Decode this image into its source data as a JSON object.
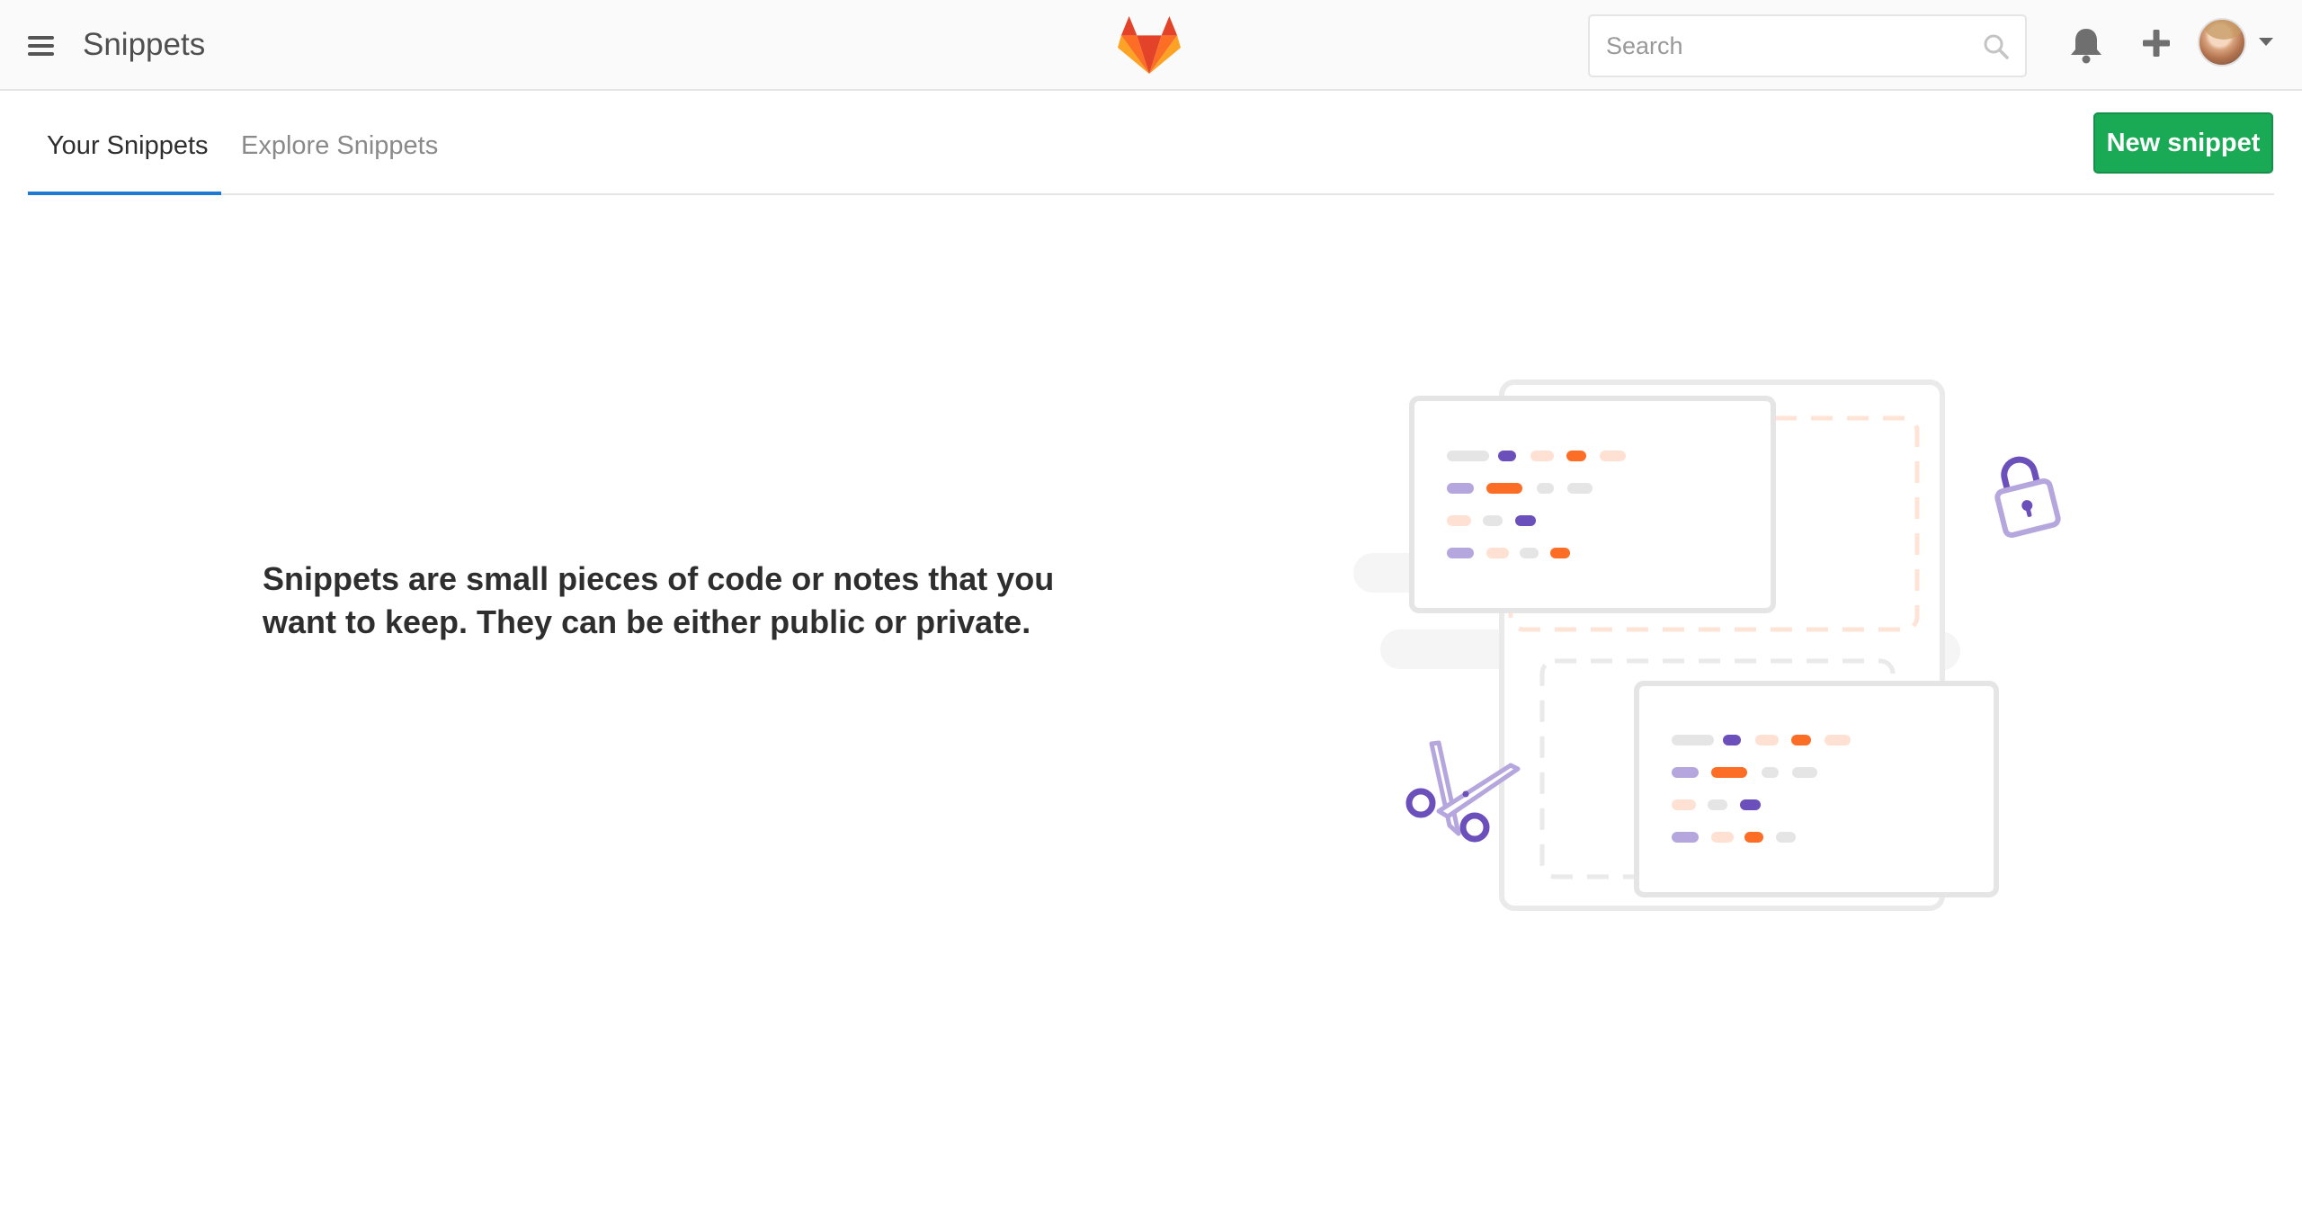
{
  "header": {
    "title": "Snippets",
    "search_placeholder": "Search",
    "icons": [
      "hamburger-menu-icon",
      "gitlab-logo",
      "search-icon",
      "bell-icon",
      "plus-icon",
      "avatar",
      "caret-down-icon"
    ]
  },
  "tabs": [
    {
      "label": "Your Snippets",
      "active": true
    },
    {
      "label": "Explore Snippets",
      "active": false
    }
  ],
  "actions": {
    "new_snippet_label": "New snippet"
  },
  "empty_state": {
    "message": "Snippets are small pieces of code or notes that you want to keep. They can be either public or private."
  },
  "colors": {
    "brand_green": "#1aaa55",
    "tab_active_underline": "#1f78d1",
    "illustration_purple": "#6b4fbb",
    "illustration_orange": "#fc6d26",
    "gitlab_logo_orange": "#e24329"
  }
}
